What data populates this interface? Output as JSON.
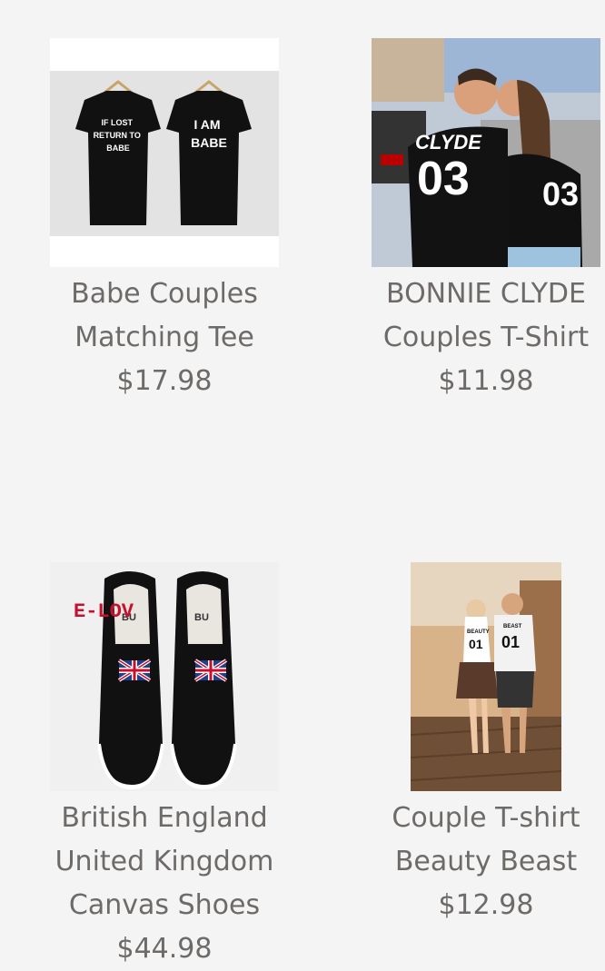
{
  "products": [
    {
      "title_lines": [
        "Babe Couples",
        "Matching Tee"
      ],
      "price": "$17.98",
      "image": {
        "shirt_left_text": "IF LOST\nRETURN TO\nBABE",
        "shirt_right_text": "I AM\nBABE"
      }
    },
    {
      "title_lines": [
        "BONNIE CLYDE",
        "Couples T-Shirt"
      ],
      "price": "$11.98",
      "image": {
        "shirt_text": "CLYDE",
        "shirt_number": "03",
        "shirt_number_right": "03"
      }
    },
    {
      "title_lines": [
        "British England",
        "United Kingdom",
        "Canvas Shoes"
      ],
      "price": "$44.98",
      "image": {
        "watermark": "E-LOV",
        "insole_text": "BU"
      }
    },
    {
      "title_lines": [
        "Couple T-shirt",
        "Beauty Beast"
      ],
      "price": "$12.98",
      "image": {
        "shirt_left_text": "BEAUTY",
        "shirt_left_number": "01",
        "shirt_right_text": "BEAST",
        "shirt_right_number": "01"
      }
    }
  ]
}
